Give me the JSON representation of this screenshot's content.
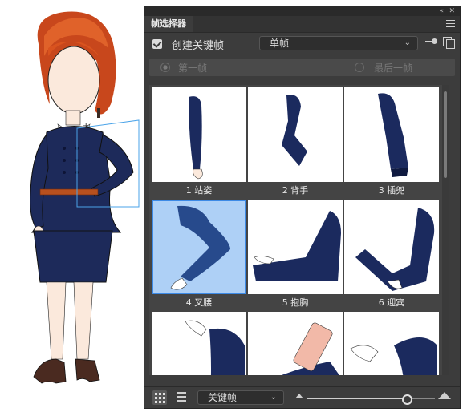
{
  "panel": {
    "title": "帧选择器",
    "create_keyframe_label": "创建关键帧",
    "create_keyframe_checked": true,
    "frame_mode_value": "单帧",
    "first_frame_label": "第一帧",
    "last_frame_label": "最后一帧"
  },
  "frames": [
    {
      "label": "1 站姿"
    },
    {
      "label": "2 背手"
    },
    {
      "label": "3 插兜"
    },
    {
      "label": "4 叉腰",
      "selected": true
    },
    {
      "label": "5 抱胸"
    },
    {
      "label": "6 迎宾"
    },
    {
      "label": ""
    },
    {
      "label": ""
    },
    {
      "label": ""
    }
  ],
  "footer": {
    "filter_value": "关键帧",
    "thumbnail_size_fraction": 0.78
  },
  "colors": {
    "panel_bg": "#3c3c3c",
    "selection_fill": "#aed0f6",
    "selection_border": "#3d8ae6",
    "sleeve_navy": "#1b2a5e"
  }
}
